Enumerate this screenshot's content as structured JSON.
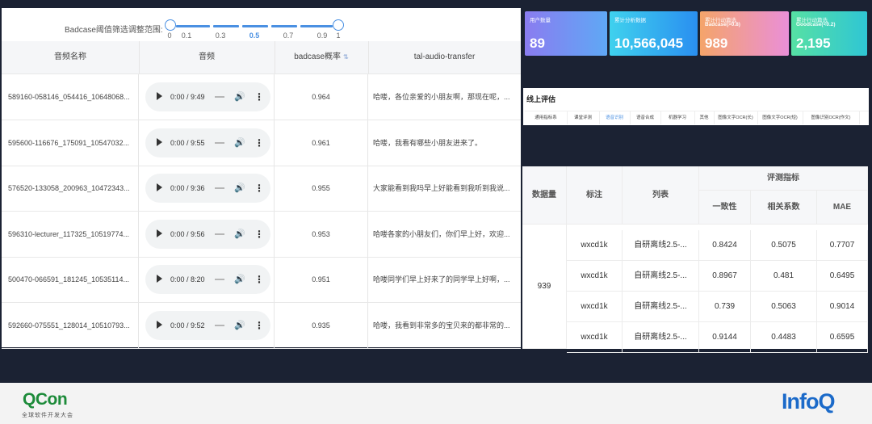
{
  "filter": {
    "label": "Badcase阈值筛选调整范围:",
    "ticks": [
      "0",
      "0.1",
      "0.3",
      "0.5",
      "0.7",
      "0.9",
      "1"
    ],
    "active_tick": "0.5",
    "range": [
      0,
      1
    ]
  },
  "table": {
    "headers": [
      "音频名称",
      "音频",
      "badcase概率",
      "tal-audio-transfer"
    ],
    "rows": [
      {
        "name": "589160-058146_054416_10648068...",
        "audio_time": "0:00 / 9:49",
        "prob": "0.964",
        "text": "哈喽，各位亲爱的小朋友啊，那现在呢，..."
      },
      {
        "name": "595600-116676_175091_10547032...",
        "audio_time": "0:00 / 9:55",
        "prob": "0.961",
        "text": "哈喽，我看有哪些小朋友进来了。"
      },
      {
        "name": "576520-133058_200963_10472343...",
        "audio_time": "0:00 / 9:36",
        "prob": "0.955",
        "text": "大家能看到我吗早上好能看到我听到我说..."
      },
      {
        "name": "596310-lecturer_117325_10519774...",
        "audio_time": "0:00 / 9:56",
        "prob": "0.953",
        "text": "哈喽各家的小朋友们，你们早上好，欢迎..."
      },
      {
        "name": "500470-066591_181245_10535114...",
        "audio_time": "0:00 / 8:20",
        "prob": "0.951",
        "text": "哈喽同学们早上好来了的同学早上好啊，..."
      },
      {
        "name": "592660-075551_128014_10510793...",
        "audio_time": "0:00 / 9:52",
        "prob": "0.935",
        "text": "哈喽，我看到非常多的宝贝来的都非常的..."
      }
    ]
  },
  "stats": [
    {
      "title": "用户数量",
      "subtitle": "",
      "value": "89",
      "color_from": "#8a7cf0",
      "color_to": "#5fa8f5"
    },
    {
      "title": "累计分析数据",
      "subtitle": "",
      "value": "10,566,045",
      "color_from": "#3fd1ee",
      "color_to": "#2a8ff0"
    },
    {
      "title": "累计行动篇选",
      "subtitle": "Badcase(>0.8)",
      "value": "989",
      "color_from": "#f4a46a",
      "color_to": "#ea8fd8"
    },
    {
      "title": "累计行动篇选",
      "subtitle": "Goodcase(<0.2)",
      "value": "2,195",
      "color_from": "#56e0a4",
      "color_to": "#2fc6d4"
    }
  ],
  "eval": {
    "title": "线上评估",
    "tabs": [
      "通用指标系",
      "课堂评测",
      "语音识别",
      "语音合成",
      "机器学习",
      "其他",
      "图像文字OCR(长)",
      "图像文字OCR(短)",
      "图像识别OCR(作文)"
    ],
    "active_tab": "语音识别"
  },
  "metrics": {
    "headers": {
      "count": "数据量",
      "tag": "标注",
      "list": "列表",
      "group": "评测指标",
      "consistency": "一致性",
      "corr": "相关系数",
      "mae": "MAE"
    },
    "count": "939",
    "rows": [
      {
        "tag": "wxcd1k",
        "list": "自研离线2.5-...",
        "consistency": "0.8424",
        "corr": "0.5075",
        "mae": "0.7707"
      },
      {
        "tag": "wxcd1k",
        "list": "自研离线2.5-...",
        "consistency": "0.8967",
        "corr": "0.481",
        "mae": "0.6495"
      },
      {
        "tag": "wxcd1k",
        "list": "自研离线2.5-...",
        "consistency": "0.739",
        "corr": "0.5063",
        "mae": "0.9014"
      },
      {
        "tag": "wxcd1k",
        "list": "自研离线2.5-...",
        "consistency": "0.9144",
        "corr": "0.4483",
        "mae": "0.6595"
      }
    ]
  },
  "footer": {
    "left_logo": "QCon",
    "left_sub": "全球软件开发大会",
    "right_logo": "InfoQ"
  }
}
